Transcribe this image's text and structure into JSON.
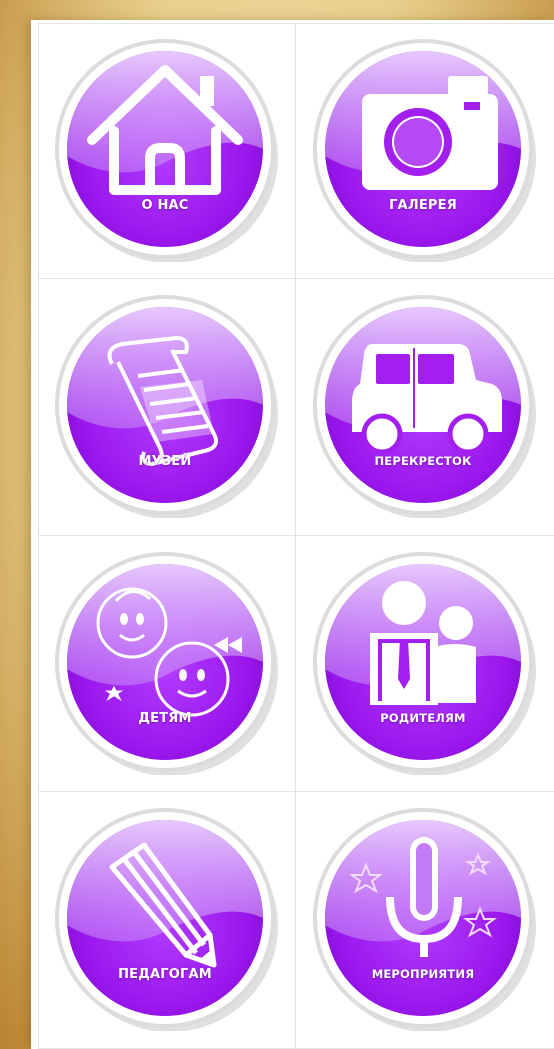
{
  "buttons": [
    {
      "label": "О НАС",
      "icon": "home-icon"
    },
    {
      "label": "ГАЛЕРЕЯ",
      "icon": "camera-icon"
    },
    {
      "label": "МУЗЕЙ",
      "icon": "scroll-icon"
    },
    {
      "label": "ПЕРЕКРЕСТОК",
      "icon": "car-icon"
    },
    {
      "label": "ДЕТЯМ",
      "icon": "children-icon"
    },
    {
      "label": "РОДИТЕЛЯМ",
      "icon": "parents-icon"
    },
    {
      "label": "ПЕДАГОГАМ",
      "icon": "pencil-icon"
    },
    {
      "label": "МЕРОПРИЯТИЯ",
      "icon": "microphone-icon"
    }
  ],
  "colors": {
    "button_purple": "#a31ff0",
    "button_purple_dark": "#7a0fd1",
    "button_purple_light": "#d9a8fb",
    "background_gold": "#e8cf8c"
  }
}
